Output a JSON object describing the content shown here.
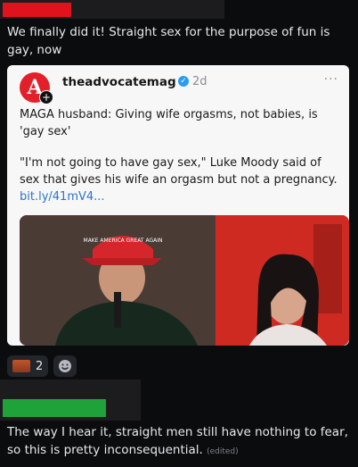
{
  "message1": {
    "text": "We finally did it! Straight sex for the purpose of fun is gay, now"
  },
  "embed": {
    "logo_letter": "A",
    "handle": "theadvocatemag",
    "age": "2d",
    "more": "···",
    "headline": "MAGA husband: Giving wife orgasms, not babies, is 'gay sex'",
    "quote": "\"I'm not going to have gay sex,\" Luke Moody said of sex that gives his wife an orgasm but not a pregnancy.",
    "link": "bit.ly/41mV4...",
    "hat_text": "MAKE AMERICA GREAT AGAIN"
  },
  "reactions": [
    {
      "count": "2"
    }
  ],
  "message2": {
    "text": "The way I hear it, straight men still have nothing to fear, so this is pretty inconsequential.",
    "edited": "(edited)"
  },
  "colors": {
    "red_redaction": "#e0121b",
    "green_redaction": "#1fa23a",
    "link": "#2b74c9",
    "verified": "#2a9af2"
  }
}
